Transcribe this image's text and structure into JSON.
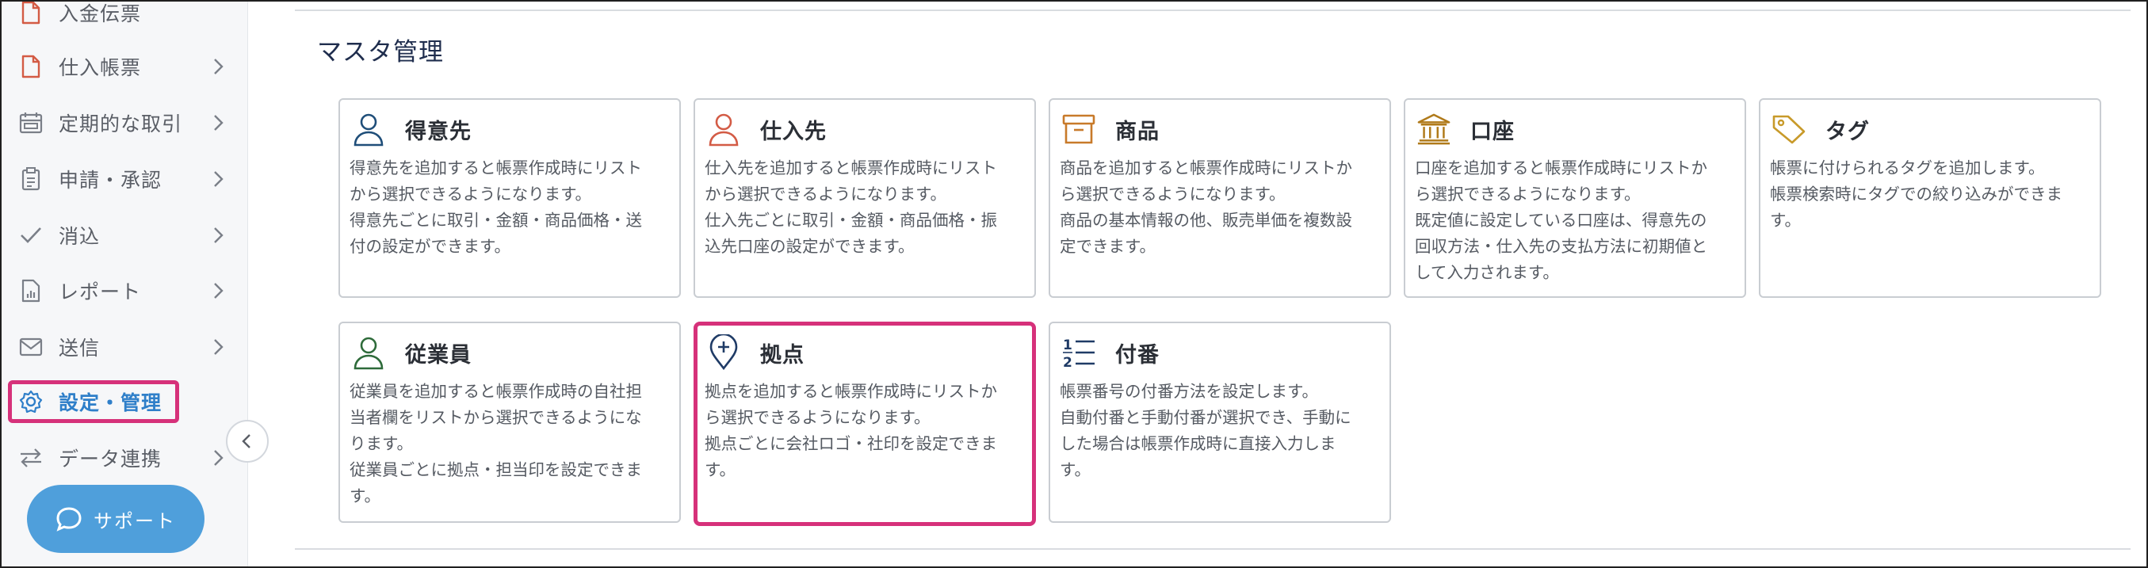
{
  "sidebar": {
    "items": [
      {
        "label": "入金伝票",
        "icon": "document-icon"
      },
      {
        "label": "仕入帳票",
        "icon": "document-icon"
      },
      {
        "label": "定期的な取引",
        "icon": "calendar-icon"
      },
      {
        "label": "申請・承認",
        "icon": "checklist-icon"
      },
      {
        "label": "消込",
        "icon": "check-icon"
      },
      {
        "label": "レポート",
        "icon": "report-icon"
      },
      {
        "label": "送信",
        "icon": "mail-icon"
      },
      {
        "label": "設定・管理",
        "icon": "gear-icon"
      },
      {
        "label": "データ連携",
        "icon": "sync-icon"
      }
    ],
    "active_label": "設定・管理",
    "support_label": "サポート"
  },
  "main": {
    "section_title": "マスタ管理",
    "cards": [
      {
        "title": "得意先",
        "icon": "person-icon",
        "color": "#1f4e79",
        "desc": "得意先を追加すると帳票作成時にリスト\nから選択できるようになります。\n得意先ごとに取引・金額・商品価格・送\n付の設定ができます。"
      },
      {
        "title": "仕入先",
        "icon": "person-icon",
        "color": "#d35b45",
        "desc": "仕入先を追加すると帳票作成時にリスト\nから選択できるようになります。\n仕入先ごとに取引・金額・商品価格・振\n込先口座の設定ができます。"
      },
      {
        "title": "商品",
        "icon": "box-icon",
        "color": "#c87a2a",
        "desc": "商品を追加すると帳票作成時にリストか\nら選択できるようになります。\n商品の基本情報の他、販売単価を複数設\n定できます。"
      },
      {
        "title": "口座",
        "icon": "bank-icon",
        "color": "#b07a1a",
        "desc": "口座を追加すると帳票作成時にリストか\nら選択できるようになります。\n既定値に設定している口座は、得意先の\n回収方法・仕入先の支払方法に初期値と\nして入力されます。"
      },
      {
        "title": "タグ",
        "icon": "tag-icon",
        "color": "#c89a2a",
        "desc": "帳票に付けられるタグを追加します。\n帳票検索時にタグでの絞り込みができま\nす。"
      },
      {
        "title": "従業員",
        "icon": "person-icon",
        "color": "#2e6b3a",
        "desc": "従業員を追加すると帳票作成時の自社担\n当者欄をリストから選択できるようにな\nります。\n従業員ごとに拠点・担当印を設定できま\nす。"
      },
      {
        "title": "拠点",
        "icon": "location-pin-icon",
        "color": "#1f3b66",
        "desc": "拠点を追加すると帳票作成時にリストか\nら選択できるようになります。\n拠点ごとに会社ロゴ・社印を設定できま\nす。"
      },
      {
        "title": "付番",
        "icon": "numbered-list-icon",
        "color": "#1f3b66",
        "desc": "帳票番号の付番方法を設定します。\n自動付番と手動付番が選択でき、手動に\nした場合は帳票作成時に直接入力しま\nす。"
      }
    ]
  },
  "colors": {
    "highlight": "#d6317a",
    "active_nav": "#2f7fc9",
    "support_button": "#4f9fdb"
  }
}
